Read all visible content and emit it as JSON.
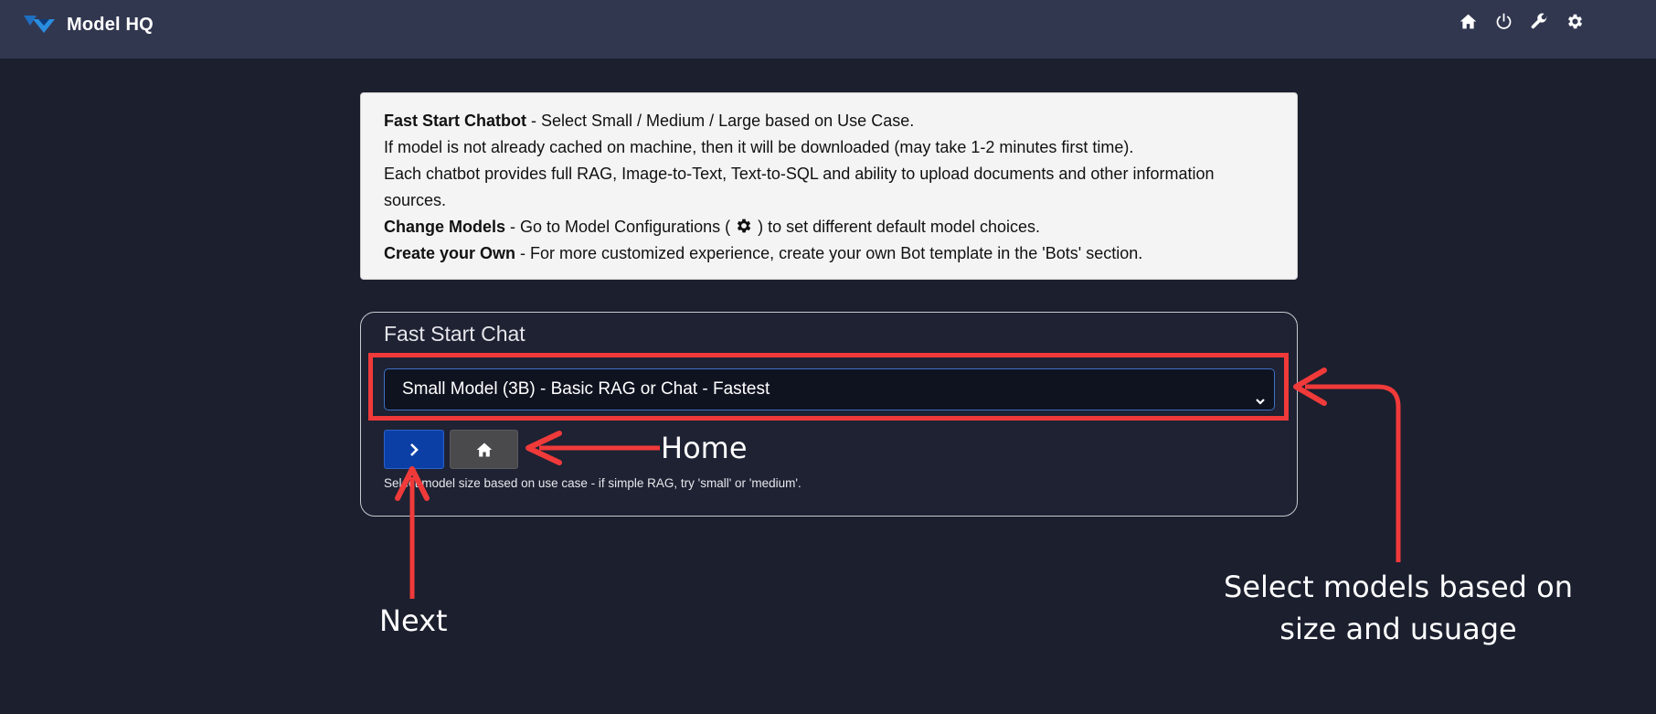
{
  "navbar": {
    "brand": "Model HQ",
    "icons": [
      "home-icon",
      "power-icon",
      "wrench-icon",
      "gear-icon"
    ]
  },
  "info": {
    "line1_bold": "Fast Start Chatbot",
    "line1_rest": " - Select Small / Medium / Large based on Use Case.",
    "line2": "If model is not already cached on machine, then it will be downloaded (may take 1-2 minutes first time).",
    "line3": "Each chatbot provides full RAG, Image-to-Text, Text-to-SQL and ability to upload documents and other information sources.",
    "line4_bold": "Change Models",
    "line4_pre": " - Go to Model Configurations ( ",
    "line4_post": " ) to set different default model choices.",
    "line5_bold": "Create your Own",
    "line5_rest": " - For more customized experience, create your own Bot template in the 'Bots' section."
  },
  "card": {
    "title": "Fast Start Chat",
    "select_value": "Small Model (3B) - Basic RAG or Chat - Fastest",
    "help_text": "Select model size based on use case - if simple RAG, try 'small' or 'medium'."
  },
  "annotations": {
    "home": "Home",
    "next": "Next",
    "select": "Select models based on size and usuage",
    "color": "#f03a3a"
  }
}
